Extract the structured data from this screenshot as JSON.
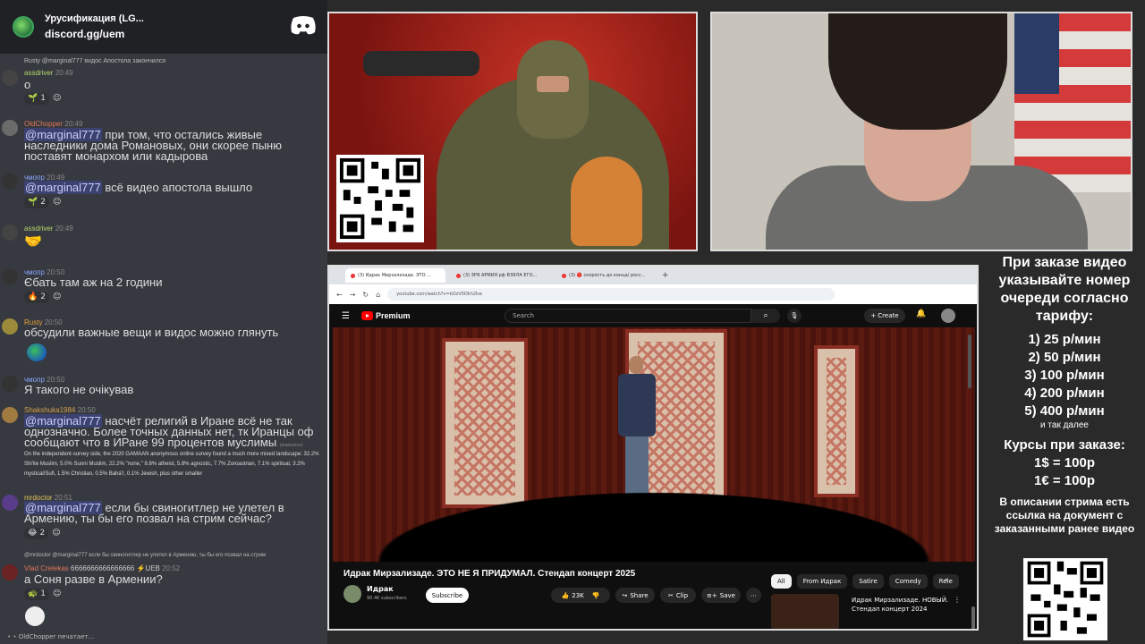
{
  "discord": {
    "server_title": "Урусификация (LG...",
    "invite": "discord.gg/uem",
    "typing_user": "OldChopper",
    "typing_text": "печатает...",
    "messages": [
      {
        "reply": "Rusty @marginal777 видос Апостола закончился",
        "user": "assdriver",
        "user_color": "#b5d66c",
        "time": "20:49",
        "text": "о",
        "reaction_count": "1"
      },
      {
        "user": "OldChopper",
        "user_color": "#e0775a",
        "time": "20:49",
        "mention": "@marginal777",
        "text_line1": " при том, что остались живые",
        "text_line2": "наследники дома Романовых, они скорее пыню",
        "text_line3": "поставят монархом или кадырова"
      },
      {
        "user": "чмопр",
        "user_color": "#8aa6ff",
        "time": "20:49",
        "mention": "@marginal777",
        "text": " всё видео апостола вышло",
        "reaction_count": "2"
      },
      {
        "user": "assdriver",
        "user_color": "#b5d66c",
        "time": "20:49",
        "text": "🤝"
      },
      {
        "user": "чмопр",
        "user_color": "#8aa6ff",
        "time": "20:50",
        "text": "Єбать там аж на 2 години",
        "reaction_count": "2"
      },
      {
        "user": "Rusty",
        "user_color": "#e7a33e",
        "time": "20:50",
        "text": "обсудили важные вещи и видос можно глянуть"
      },
      {
        "user": "чмопр",
        "user_color": "#8aa6ff",
        "time": "20:50",
        "text": "Я такого не очікував"
      },
      {
        "user": "Shakshuka1984",
        "user_color": "#d6a04f",
        "time": "20:50",
        "mention": "@marginal777",
        "text_line1": " насчёт религий в Иране всё не так",
        "text_line2": "однозначно. Более точных данных нет, тк Иранцы оф",
        "text_line3": "сообщают что в ИРане 99 процентов муслимы",
        "edited": "(изменено)",
        "embed": "On the independent-survey side, the 2020 GAMAAN anonymous online survey found a much more mixed landscape: 32.2% Shi'ite Muslim, 5.0% Sunni Muslim, 22.2% \"none,\" 8.8% atheist, 5.8% agnostic, 7.7% Zoroastrian, 7.1% spiritual, 3.2% mystical/Sufi, 1.5% Christian, 0.5% Bahá'í, 0.1% Jewish, plus other smaller"
      },
      {
        "user": "mrdoctor",
        "user_color": "#e0c35a",
        "time": "20:51",
        "mention": "@marginal777",
        "text_line1": " если бы свиногитлер не улетел в",
        "text_line2": "Армению, ты бы его позвал на стрим сейчас?",
        "reaction_count": "2"
      },
      {
        "reply": "@mrdoctor @marginal777 если бы свиногитлер не улетел в Армению, ты бы его позвал на стрим",
        "user": "Vlad Crelekas",
        "user_color": "#e0775a",
        "user_suffix": "6666666666666666 ⚡UEB",
        "time": "20:52",
        "text": "а Соня разве в Армении?",
        "reaction_count": "1"
      }
    ]
  },
  "browser": {
    "tabs": [
      "(3) Идрак Мирзализаде. ЭТО ...",
      "(3) ЗРЯ АРМИЯ рф ВЗЯЛА ЕГО...",
      "(3) 🔴 скорость до конца/ росс..."
    ],
    "url": "youtube.com/watch?v=bOzV0Okh2kw",
    "search_placeholder": "Search",
    "premium_label": "Premium",
    "create_label": "Create",
    "notif_count": "9+",
    "video_title": "Идрак Мирзализаде. ЭТО НЕ Я ПРИДУМАЛ. Стендап концерт 2025",
    "channel_name": "Идрак",
    "subscribers": "90.4K subscribers",
    "subscribe": "Subscribe",
    "likes": "23K",
    "share": "Share",
    "clip": "Clip",
    "save": "Save",
    "chips": [
      "All",
      "From Идрак",
      "Satire",
      "Comedy",
      "Rele"
    ],
    "rec_title": "Идрак Мирзализаде. НОВЫЙ. Стендап концерт 2024"
  },
  "pricing": {
    "heading": "При заказе видео указывайте номер очереди согласно тарифу:",
    "tiers": [
      "1) 25 р/мин",
      "2) 50 р/мин",
      "3) 100 р/мин",
      "4) 200 р/мин",
      "5) 400 р/мин"
    ],
    "etc": "и так далее",
    "currency_heading": "Курсы при заказе:",
    "rates": [
      "1$ = 100р",
      "1€ = 100р"
    ],
    "doc_note": "В описании стрима есть ссылка на документ с заказанными ранее видео"
  },
  "colors": {
    "discord_bg": "#36393f",
    "mention_bg": "#3c4270",
    "youtube_red": "#ff0000",
    "art_red": "#c73325"
  }
}
